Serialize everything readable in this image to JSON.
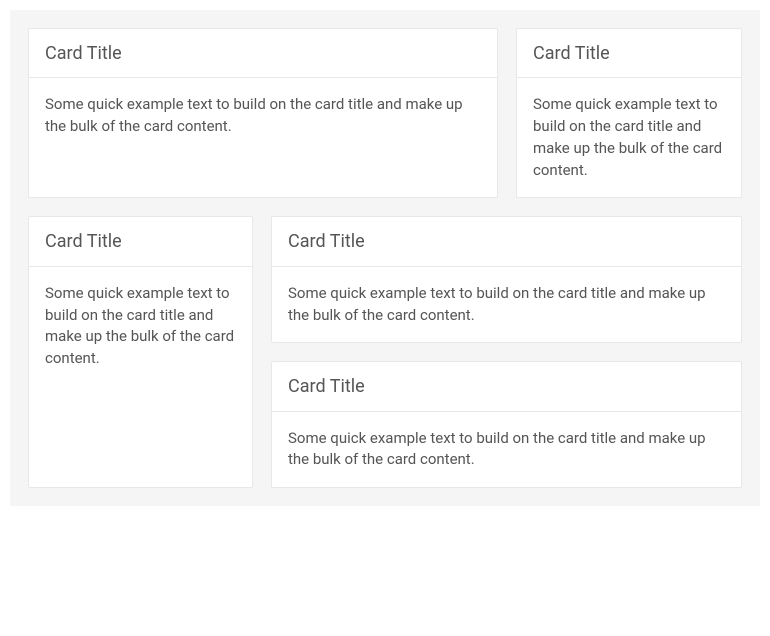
{
  "cards": [
    {
      "title": "Card Title",
      "text": "Some quick example text to build on the card title and make up the bulk of the card content."
    },
    {
      "title": "Card Title",
      "text": "Some quick example text to build on the card title and make up the bulk of the card content."
    },
    {
      "title": "Card Title",
      "text": "Some quick example text to build on the card title and make up the bulk of the card content."
    },
    {
      "title": "Card Title",
      "text": "Some quick example text to build on the card title and make up the bulk of the card content."
    },
    {
      "title": "Card Title",
      "text": "Some quick example text to build on the card title and make up the bulk of the card content."
    }
  ]
}
